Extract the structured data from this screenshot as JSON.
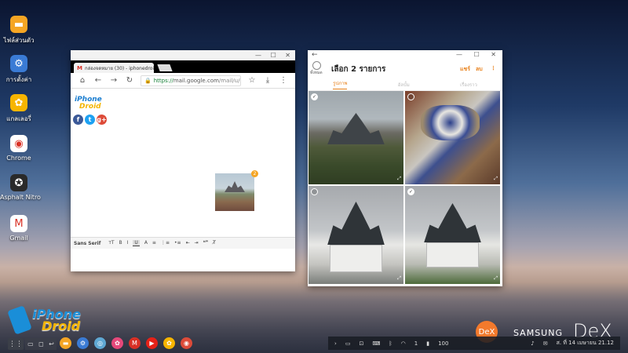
{
  "desktop": {
    "icons": [
      {
        "name": "my-files",
        "label": "ไฟล์ส่วนตัว",
        "glyph": "▬",
        "color": "#f5a524"
      },
      {
        "name": "settings",
        "label": "การตั้งค่า",
        "glyph": "⚙",
        "color": "#3a7bd5"
      },
      {
        "name": "gallery",
        "label": "แกลเลอรี่",
        "glyph": "✿",
        "color": "#f7b500"
      },
      {
        "name": "chrome",
        "label": "Chrome",
        "glyph": "◉",
        "color": "#ffffff"
      },
      {
        "name": "asphalt",
        "label": "Asphalt Nitro",
        "glyph": "✪",
        "color": "#2a2a2a"
      },
      {
        "name": "gmail",
        "label": "Gmail",
        "glyph": "M",
        "color": "#ffffff"
      }
    ]
  },
  "chrome_window": {
    "controls": {
      "minimize": "—",
      "maximize": "☐",
      "close": "✕"
    },
    "tab_title": "กล่องจดหมาย (30) - iphonedroid",
    "tab_icon": "M",
    "url_https": "https://",
    "url_domain": "mail.google.com",
    "url_rest": "/mail/u/0/?ui=2#inbox",
    "attachment_count": "2",
    "social": {
      "fb": "f",
      "tw": "t",
      "gp": "g+"
    },
    "mini_logo": {
      "line1": "iPhone",
      "line2": "Droid"
    },
    "format_toolbar": {
      "font": "Sans Serif",
      "items": [
        "ᴛT",
        "B",
        "I",
        "U",
        "A",
        "≡",
        "⋮≡",
        "•≡",
        "⇤",
        "⇥",
        "❝❞",
        "T̸"
      ]
    }
  },
  "gallery_window": {
    "controls": {
      "minimize": "—",
      "maximize": "☐",
      "close": "✕"
    },
    "back": "←",
    "select_all_label": "ทั้งหมด",
    "title": "เลือก 2 รายการ",
    "share": "แชร์",
    "delete": "ลบ",
    "more": "⋮",
    "tabs": [
      "รูปภาพ",
      "อัลบั้ม",
      "เรื่องราว"
    ],
    "active_tab": 0,
    "photos": [
      {
        "selected": true,
        "check": "✓"
      },
      {
        "selected": false,
        "check": ""
      },
      {
        "selected": false,
        "check": ""
      },
      {
        "selected": true,
        "check": "✓"
      }
    ]
  },
  "branding": {
    "logo_line1": "iPhone",
    "logo_line2": "Droid",
    "dex_badge": "DeX",
    "samsung": "SAMSUNG",
    "dex": "DeX"
  },
  "taskbar": {
    "apps_glyph": "⋮⋮",
    "recent_glyphs": [
      "▭",
      "◻",
      "↩"
    ],
    "pinned_apps": [
      {
        "name": "files",
        "glyph": "▬",
        "color": "#f5a524"
      },
      {
        "name": "settings",
        "glyph": "⚙",
        "color": "#3a7bd5"
      },
      {
        "name": "camera",
        "glyph": "◎",
        "color": "#5fa8d3"
      },
      {
        "name": "gallery",
        "glyph": "✿",
        "color": "#e6487a"
      },
      {
        "name": "gmail",
        "glyph": "M",
        "color": "#d93025"
      },
      {
        "name": "youtube",
        "glyph": "▶",
        "color": "#e62117"
      },
      {
        "name": "gallery2",
        "glyph": "✿",
        "color": "#f7b500"
      },
      {
        "name": "chrome",
        "glyph": "◉",
        "color": "#dd4b39"
      }
    ],
    "tray": {
      "expand": "›",
      "battery_pct": "100",
      "date_time": "ส. ที่ 14 เมษายน 21.12",
      "notif_count": "1"
    }
  }
}
